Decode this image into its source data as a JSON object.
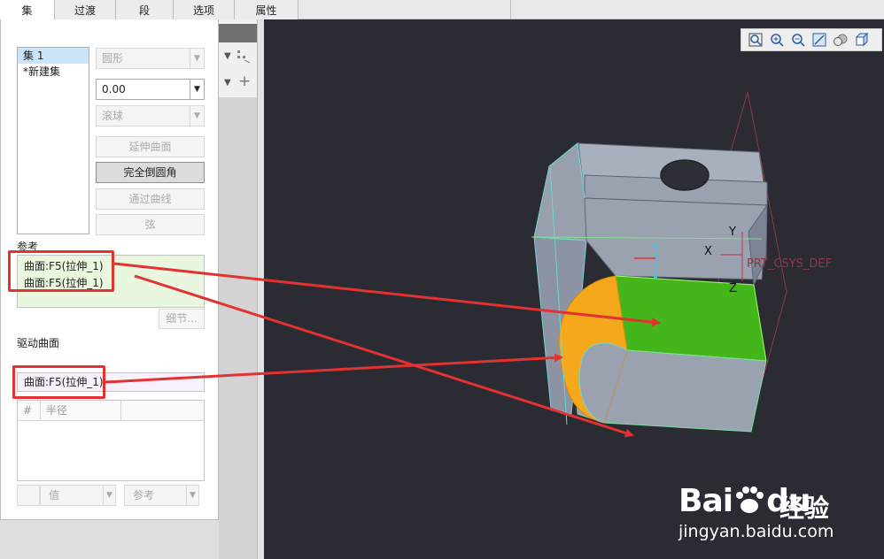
{
  "tabs": [
    {
      "label": "集",
      "active": true
    },
    {
      "label": "过渡",
      "active": false
    },
    {
      "label": "段",
      "active": false
    },
    {
      "label": "选项",
      "active": false
    },
    {
      "label": "属性",
      "active": false
    }
  ],
  "sets": {
    "items": [
      {
        "label": "集 1",
        "selected": true
      },
      {
        "label": "*新建集",
        "selected": false
      }
    ]
  },
  "controls": {
    "shape_select": "圆形",
    "radius_value": "0.00",
    "method_select": "滚球",
    "btn_extend": "延伸曲面",
    "btn_full_round": "完全倒圆角",
    "btn_through_curve": "通过曲线",
    "btn_chord": "弦"
  },
  "references": {
    "label": "参考",
    "items": [
      "曲面:F5(拉伸_1)",
      "曲面:F5(拉伸_1)"
    ],
    "details_button": "细节..."
  },
  "driving_surface": {
    "label": "驱动曲面",
    "value": "曲面:F5(拉伸_1)"
  },
  "radius_table": {
    "columns": [
      "#",
      "半径"
    ]
  },
  "bottom": {
    "value_select": "值",
    "ref_select": "参考"
  },
  "viewport": {
    "tools": [
      "zoom-fit-icon",
      "zoom-in-icon",
      "zoom-out-icon",
      "repaint-icon",
      "display-style-icon",
      "saved-view-icon"
    ],
    "labels": {
      "axis_y": "Y",
      "axis_x": "X",
      "axis_z": "Z",
      "csys": "PRT_CSYS_DEF"
    }
  },
  "watermark": {
    "brand": "Bai",
    "brand2": "du",
    "jingyan": "经验",
    "url": "jingyan.baidu.com"
  },
  "colors": {
    "viewport_bg": "#2b2b33",
    "annotation_red": "#e23232",
    "highlight_green": "#44b51a",
    "round_orange": "#f5a81c",
    "model_gray": "#9aa2b0"
  }
}
